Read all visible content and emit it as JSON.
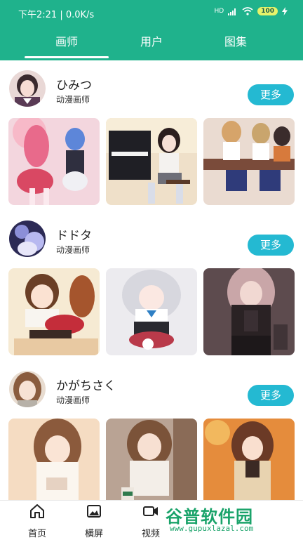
{
  "status_bar": {
    "time": "下午2:21 | 0.0K/s",
    "signal": "HD",
    "battery": "100"
  },
  "tabs": [
    {
      "label": "画师"
    },
    {
      "label": "用户"
    },
    {
      "label": "图集"
    }
  ],
  "artists": [
    {
      "name": "ひみつ",
      "role": "动漫画师",
      "more_label": "更多"
    },
    {
      "name": "ドドタ",
      "role": "动漫画师",
      "more_label": "更多"
    },
    {
      "name": "かがちさく",
      "role": "动漫画师",
      "more_label": "更多"
    }
  ],
  "bottom_nav": [
    {
      "label": "首页",
      "icon": "home-icon"
    },
    {
      "label": "横屏",
      "icon": "image-icon"
    },
    {
      "label": "视频",
      "icon": "video-icon"
    }
  ],
  "watermark": {
    "title": "谷普软件园",
    "url": "www.gupuxlazal.com"
  },
  "colors": {
    "primary": "#1fb28c",
    "button": "#24b9d2"
  }
}
